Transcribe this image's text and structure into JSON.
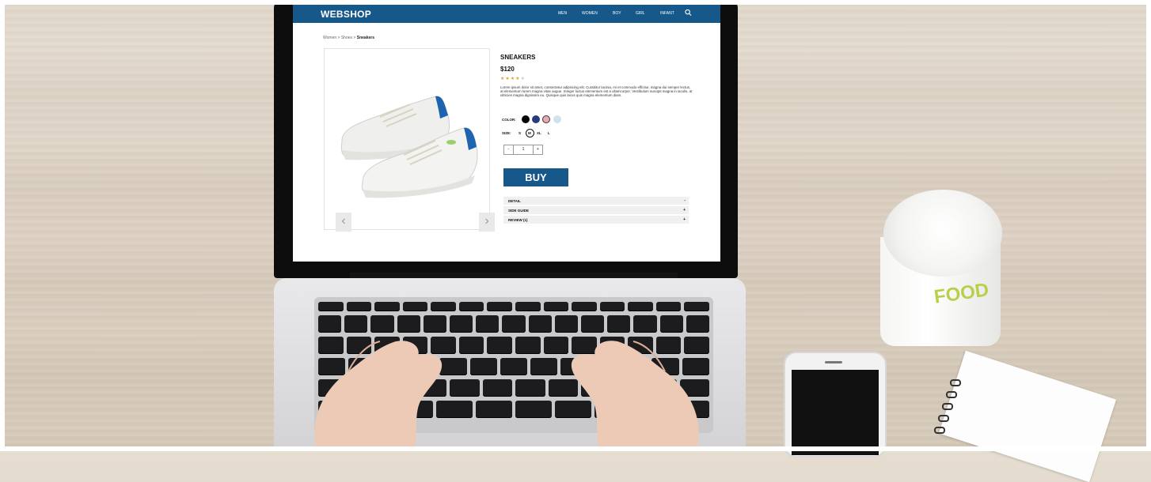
{
  "shop": {
    "logo": "WEBSHOP",
    "nav": [
      "MEN",
      "WOMEN",
      "BOY",
      "GIRL",
      "INFANT"
    ],
    "breadcrumb": {
      "item1": "Women",
      "sep1": ">",
      "item2": "Shoes",
      "sep2": ">",
      "current": "Sneakers"
    }
  },
  "product": {
    "title": "SNEAKERS",
    "price": "$120",
    "rating": {
      "filled": 4,
      "total": 5
    },
    "description": "Lorem ipsum dolor sit amet, consectetur adipiscing elit. Curabitur lacinia, mi et commodo efficitur, magna dui semper lectus, at elementum lorem magna vitae augue. Integer luctus elementum est a ullamcorper. Vestibulum suscipit magna in iaculis, at ultricies magna dignissim eu. Quisque quis lacus quis magna elementum diam.",
    "color_label": "COLOR:",
    "colors": [
      "#000000",
      "#2a3a7c",
      "#e9a9b0",
      "#cfe3ec"
    ],
    "size_label": "SIZE:",
    "sizes": [
      "S",
      "M",
      "XL",
      "L"
    ],
    "selected_size": "M",
    "qty": {
      "minus": "-",
      "value": "1",
      "plus": "+"
    },
    "buy_label": "BUY",
    "prev": "‹",
    "next": "›",
    "accordion": [
      {
        "label": "DETAIL",
        "icon": "-"
      },
      {
        "label": "SIDE GUIDE",
        "icon": "+"
      },
      {
        "label": "REVIEW (1)",
        "icon": "+"
      }
    ]
  },
  "cup": {
    "brand": "FOOD"
  },
  "icons": {
    "search": "search-icon",
    "prev": "chevron-left-icon",
    "next": "chevron-right-icon"
  }
}
